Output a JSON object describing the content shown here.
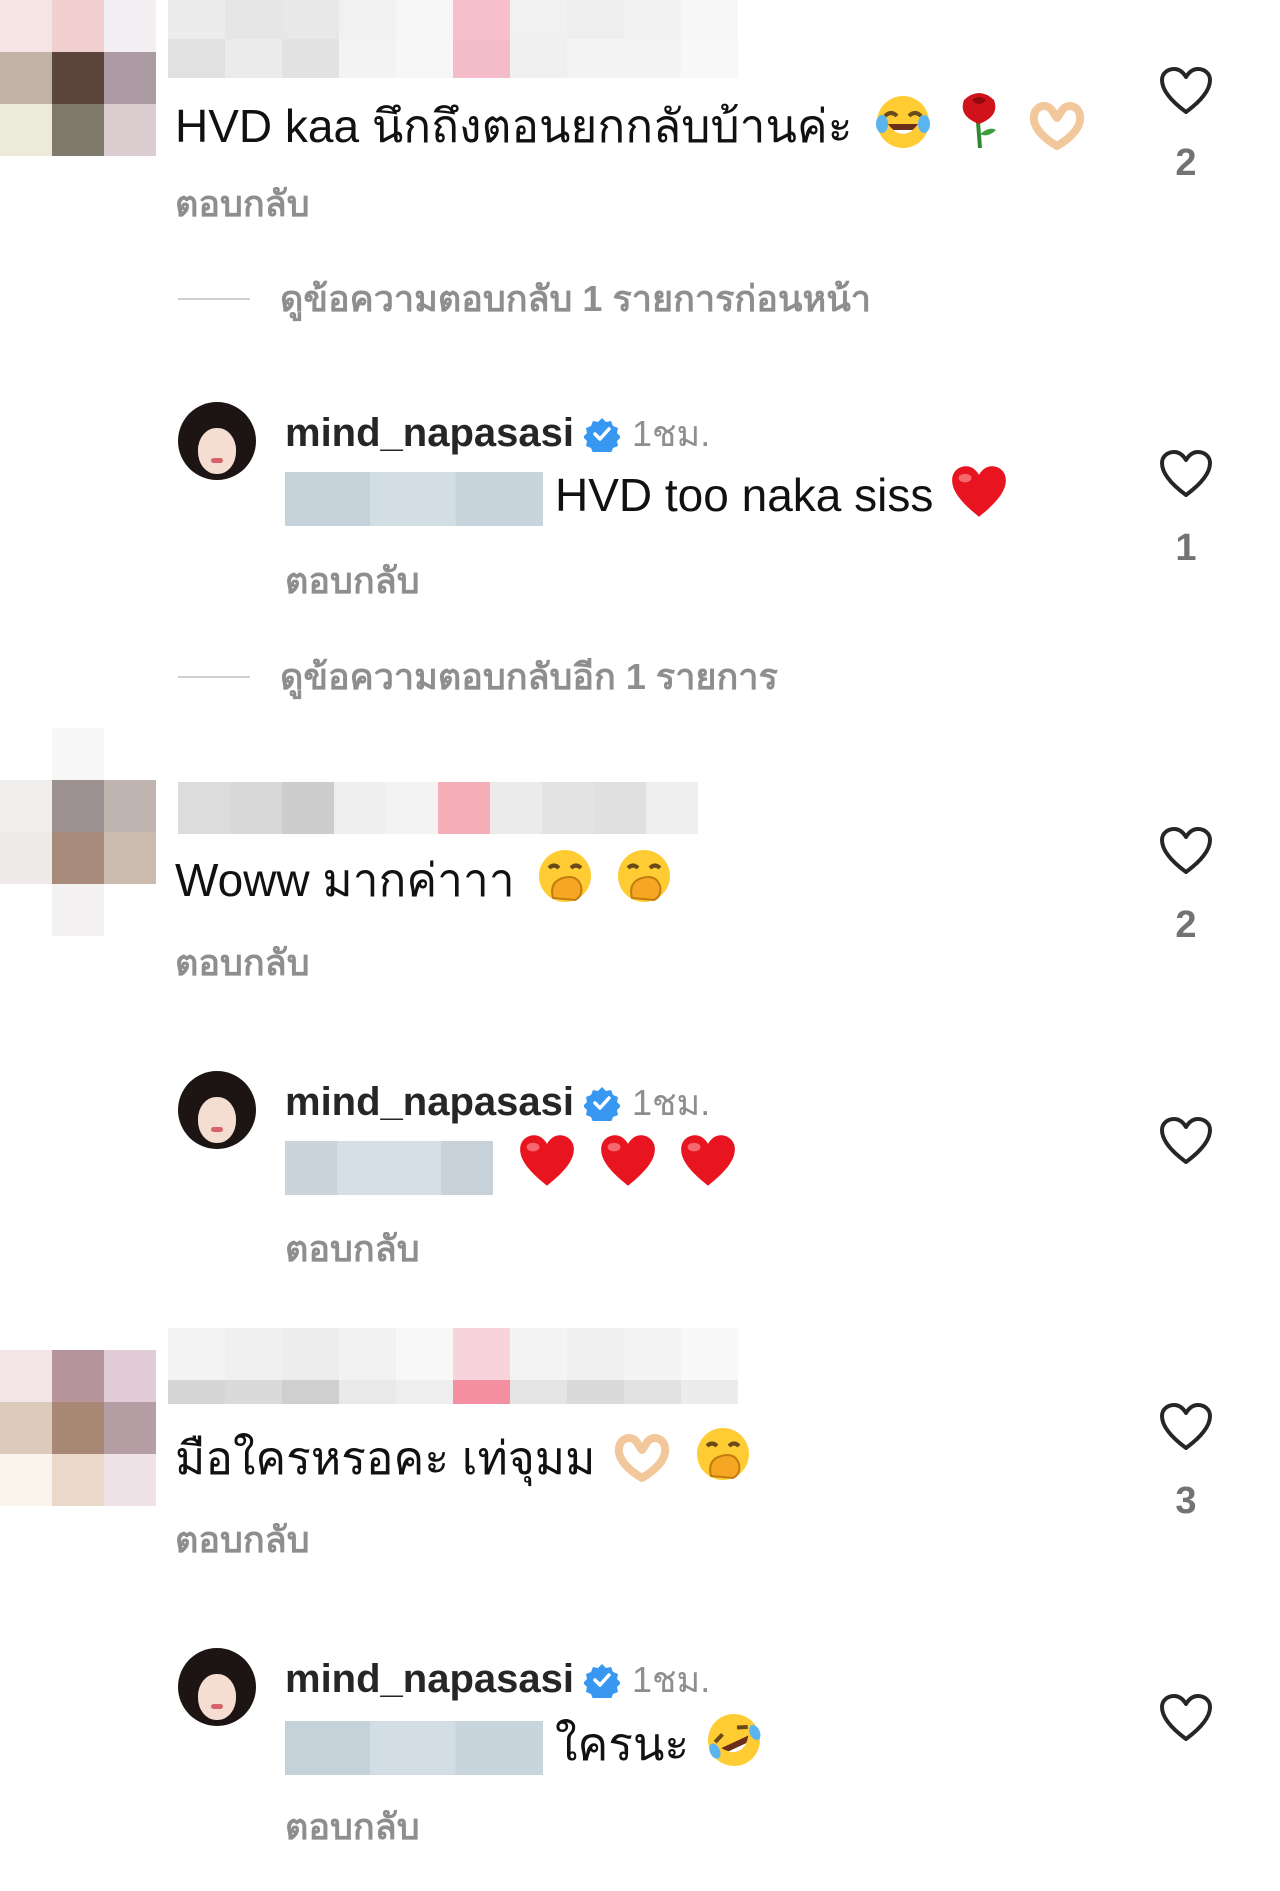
{
  "comments": [
    {
      "text": "HVD kaa นึกถึงตอนยกกลับบ้านค่ะ",
      "emojis": [
        "laughing-tears",
        "rose",
        "heart-hands"
      ],
      "reply_label": "ตอบกลับ",
      "likes": "2",
      "view_replies": "ดูข้อความตอบกลับ 1 รายการก่อนหน้า",
      "reply": {
        "username": "mind_napasasi",
        "time": "1ชม.",
        "text": "HVD too naka siss",
        "emojis": [
          "red-heart"
        ],
        "reply_label": "ตอบกลับ",
        "likes": "1"
      },
      "view_more_replies": "ดูข้อความตอบกลับอีก 1 รายการ"
    },
    {
      "text": "Woww มากค่าาา",
      "emojis": [
        "hand-over-mouth",
        "hand-over-mouth"
      ],
      "reply_label": "ตอบกลับ",
      "likes": "2",
      "reply": {
        "username": "mind_napasasi",
        "time": "1ชม.",
        "text": "",
        "emojis": [
          "red-heart",
          "red-heart",
          "red-heart"
        ],
        "reply_label": "ตอบกลับ",
        "likes": ""
      }
    },
    {
      "text": "มือใครหรอคะ เท่จุมม",
      "emojis": [
        "heart-hands",
        "hand-over-mouth"
      ],
      "reply_label": "ตอบกลับ",
      "likes": "3",
      "reply": {
        "username": "mind_napasasi",
        "time": "1ชม.",
        "text": "ใครนะ",
        "emojis": [
          "rolling-laughing"
        ],
        "reply_label": "ตอบกลับ",
        "likes": ""
      }
    }
  ],
  "colors": {
    "verified": "#3897f0",
    "muted": "#8e8e8e",
    "heart_outline": "#262626",
    "mention_blur": "#c9d4dc"
  },
  "icons": [
    "heart-outline-icon",
    "verified-badge-icon",
    "avatar"
  ]
}
